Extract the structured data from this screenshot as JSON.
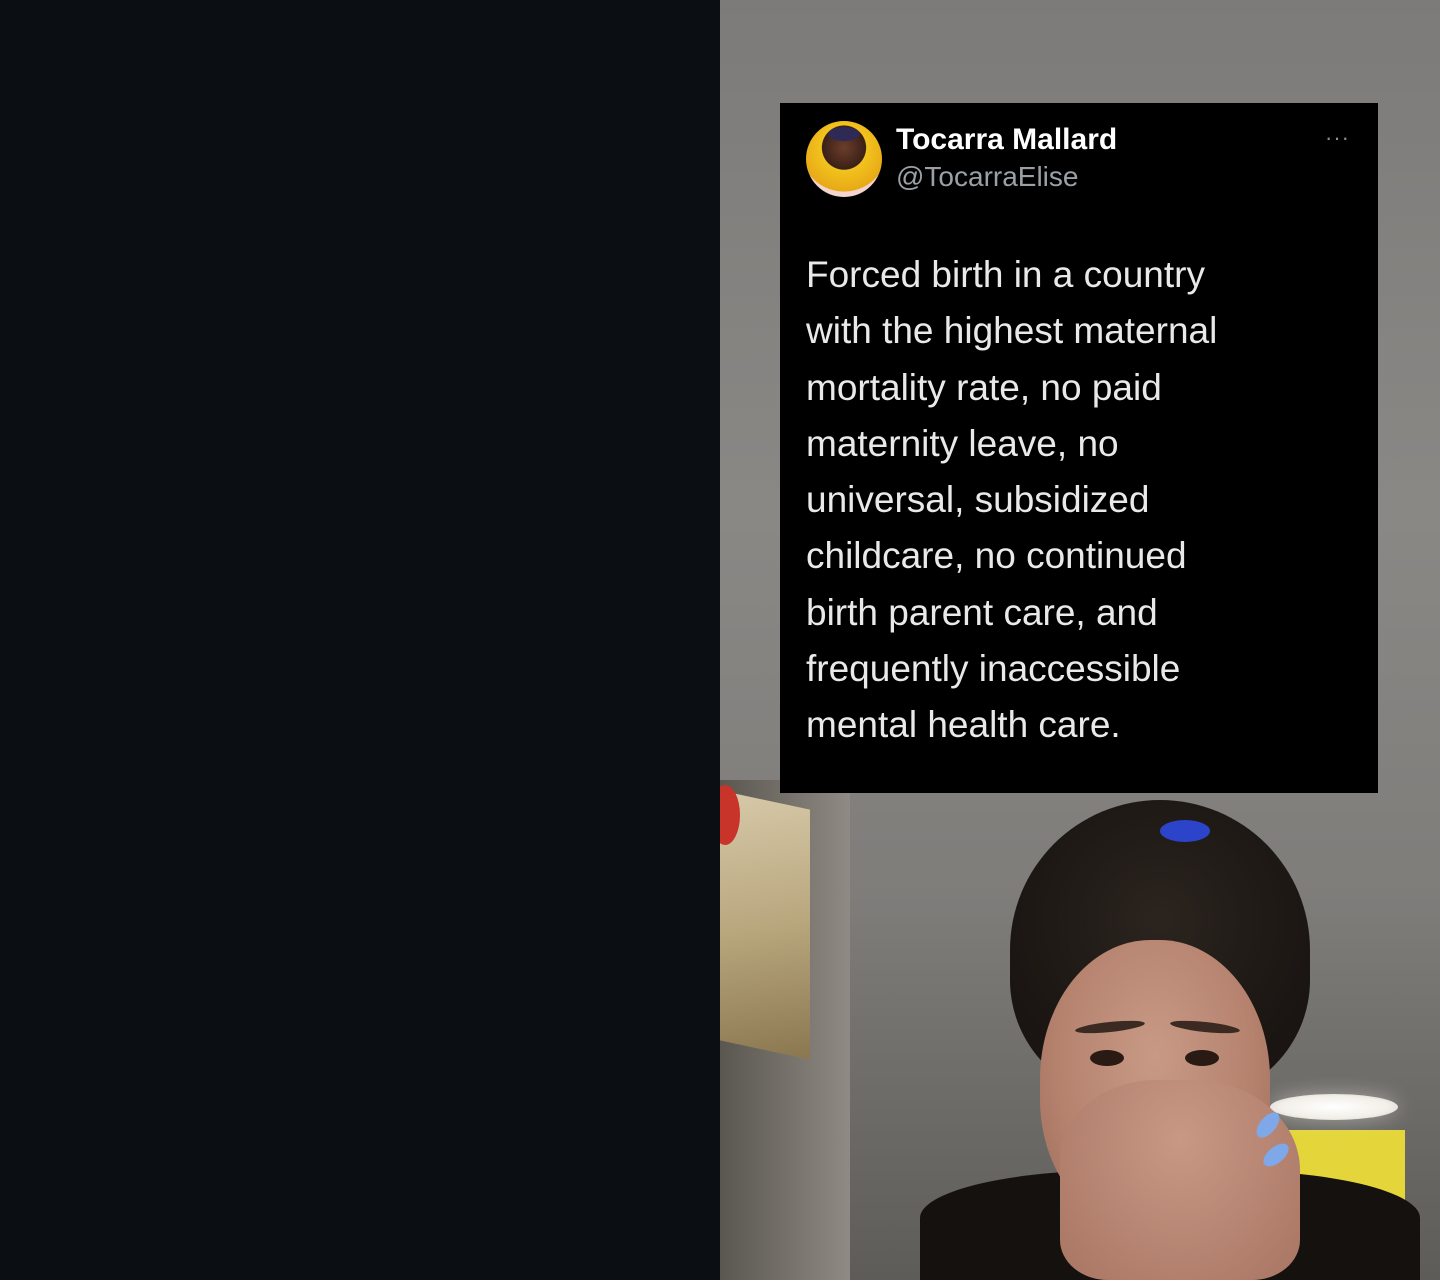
{
  "tweet": {
    "display_name": "Tocarra Mallard",
    "handle": "@TocarraElise",
    "more_icon": "more-horizontal-icon",
    "more_glyph": "···",
    "lines": [
      "Forced birth in a country",
      "with the highest maternal",
      "mortality rate, no paid",
      "maternity leave, no",
      "universal, subsidized",
      "childcare, no continued",
      "birth parent care, and",
      "frequently inaccessible",
      "mental health care."
    ]
  },
  "colors": {
    "card_background": "#000000",
    "left_panel_background": "#0b0e12",
    "name_color": "#ffffff",
    "handle_color": "#9aa0a6",
    "text_color": "#e9e9e9"
  }
}
